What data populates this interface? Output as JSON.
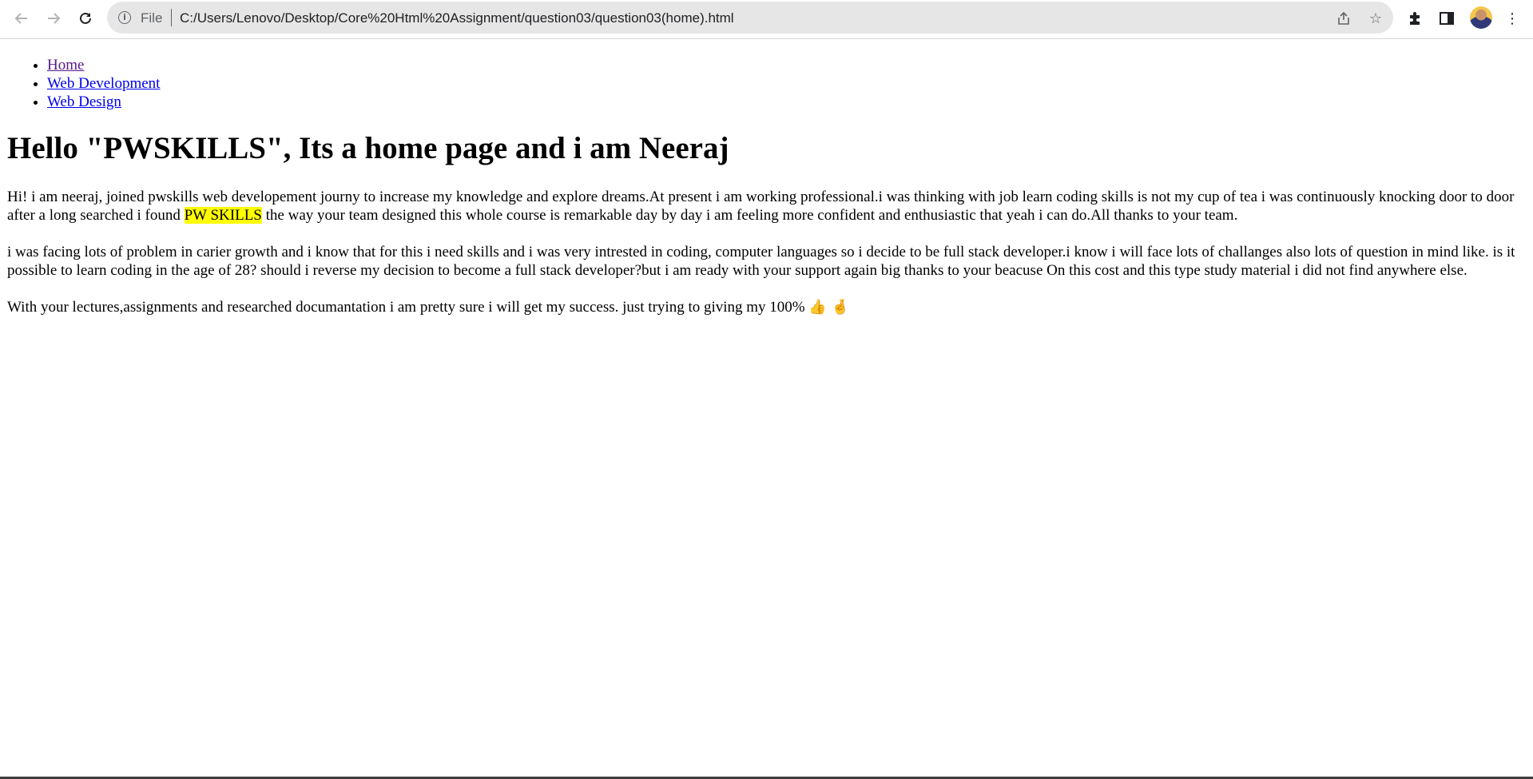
{
  "browser": {
    "url_scheme_label": "File",
    "url": "C:/Users/Lenovo/Desktop/Core%20Html%20Assignment/question03/question03(home).html",
    "icons": {
      "back": "arrow-left-icon",
      "forward": "arrow-right-icon",
      "reload": "reload-icon",
      "info": "info-icon",
      "share": "share-icon",
      "bookmark": "star-icon",
      "extensions": "puzzle-icon",
      "side_panel": "side-panel-icon",
      "menu": "kebab-menu-icon"
    }
  },
  "nav": {
    "items": [
      {
        "label": "Home"
      },
      {
        "label": "Web Development"
      },
      {
        "label": "Web Design"
      }
    ]
  },
  "content": {
    "heading": "Hello \"PWSKILLS\", Its a home page and i am Neeraj",
    "para1_before": "Hi! i am neeraj, joined pwskills web developement journy to increase my knowledge and explore dreams.At present i am working professional.i was thinking with job learn coding skills is not my cup of tea i was continuously knocking door to door after a long searched i found ",
    "para1_highlight": "PW SKILLS",
    "para1_after": " the way your team designed this whole course is remarkable day by day i am feeling more confident and enthusiastic that yeah i can do.All thanks to your team.",
    "para2": "i was facing lots of problem in carier growth and i know that for this i need skills and i was very intrested in coding, computer languages so i decide to be full stack developer.i know i will face lots of challanges also lots of question in mind like. is it possible to learn coding in the age of 28? should i reverse my decision to become a full stack developer?but i am ready with your support again big thanks to your beacuse On this cost and this type study material i did not find anywhere else.",
    "para3": "With your lectures,assignments and researched documantation i am pretty sure i will get my success. just trying to giving my 100%",
    "para3_emojis": "👍 🤞"
  },
  "colors": {
    "link": "#0000ee",
    "visited_link": "#551a8b",
    "highlight": "#ffff00"
  }
}
